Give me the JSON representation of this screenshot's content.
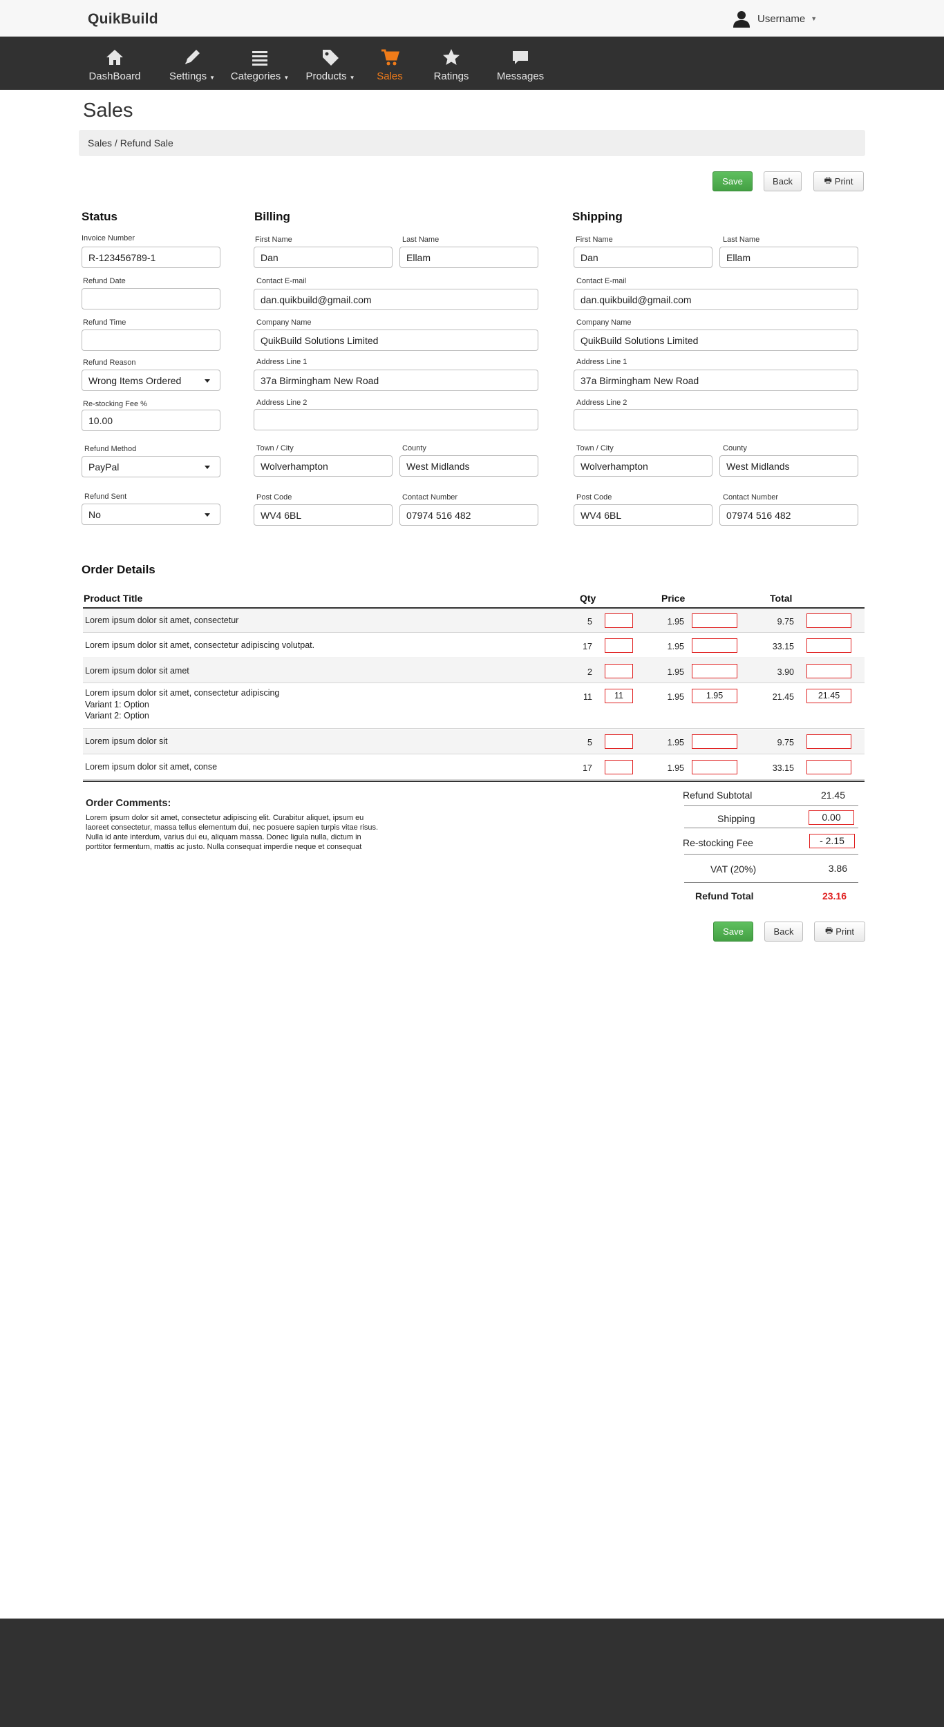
{
  "brand": "QuikBuild",
  "user": {
    "name": "Username"
  },
  "nav": [
    {
      "label": "DashBoard",
      "icon": "home-icon"
    },
    {
      "label": "Settings",
      "icon": "pencil-icon"
    },
    {
      "label": "Categories",
      "icon": "list-icon"
    },
    {
      "label": "Products",
      "icon": "tag-icon"
    },
    {
      "label": "Sales",
      "icon": "cart-icon"
    },
    {
      "label": "Ratings",
      "icon": "star-icon"
    },
    {
      "label": "Messages",
      "icon": "chat-icon"
    }
  ],
  "page": {
    "title": "Sales",
    "breadcrumb": "Sales / Refund Sale"
  },
  "buttons": {
    "save": "Save",
    "back": "Back",
    "print": "Print"
  },
  "status": {
    "heading": "Status",
    "invoice_label": "Invoice Number",
    "invoice": "R-123456789-1",
    "refund_date_label": "Refund Date",
    "refund_date": "",
    "refund_time_label": "Refund Time",
    "refund_time": "",
    "reason_label": "Refund Reason",
    "reason": "Wrong Items Ordered",
    "fee_label": "Re-stocking Fee %",
    "fee": "10.00",
    "method_label": "Refund Method",
    "method": "PayPal",
    "sent_label": "Refund Sent",
    "sent": "No"
  },
  "billing": {
    "heading": "Billing",
    "first_name_label": "First Name",
    "first_name": "Dan",
    "last_name_label": "Last Name",
    "last_name": "Ellam",
    "email_label": "Contact E-mail",
    "email": "dan.quikbuild@gmail.com",
    "company_label": "Company Name",
    "company": "QuikBuild Solutions Limited",
    "addr1_label": "Address Line 1",
    "addr1": "37a Birmingham New Road",
    "addr2_label": "Address Line 2",
    "addr2": "",
    "town_label": "Town / City",
    "town": "Wolverhampton",
    "county_label": "County",
    "county": "West Midlands",
    "postcode_label": "Post Code",
    "postcode": "WV4 6BL",
    "phone_label": "Contact Number",
    "phone": "07974 516 482"
  },
  "shipping": {
    "heading": "Shipping",
    "first_name_label": "First Name",
    "first_name": "Dan",
    "last_name_label": "Last Name",
    "last_name": "Ellam",
    "email_label": "Contact E-mail",
    "email": "dan.quikbuild@gmail.com",
    "company_label": "Company Name",
    "company": "QuikBuild Solutions Limited",
    "addr1_label": "Address Line 1",
    "addr1": "37a Birmingham New Road",
    "addr2_label": "Address Line 2",
    "addr2": "",
    "town_label": "Town / City",
    "town": "Wolverhampton",
    "county_label": "County",
    "county": "West Midlands",
    "postcode_label": "Post Code",
    "postcode": "WV4 6BL",
    "phone_label": "Contact Number",
    "phone": "07974 516 482"
  },
  "order": {
    "heading": "Order Details",
    "col_title": "Product Title",
    "col_qty": "Qty",
    "col_price": "Price",
    "col_total": "Total",
    "rows": [
      {
        "title": "Lorem ipsum dolor sit amet, consectetur",
        "variants": [],
        "qty": "5",
        "price": "1.95",
        "total": "9.75",
        "qty_in": "",
        "price_in": "",
        "total_in": ""
      },
      {
        "title": "Lorem ipsum dolor sit amet, consectetur adipiscing volutpat.",
        "variants": [],
        "qty": "17",
        "price": "1.95",
        "total": "33.15",
        "qty_in": "",
        "price_in": "",
        "total_in": ""
      },
      {
        "title": "Lorem ipsum dolor sit amet",
        "variants": [],
        "qty": "2",
        "price": "1.95",
        "total": "3.90",
        "qty_in": "",
        "price_in": "",
        "total_in": ""
      },
      {
        "title": "Lorem ipsum dolor sit amet, consectetur adipiscing",
        "variants": [
          "Variant 1: Option",
          "Variant 2: Option"
        ],
        "qty": "11",
        "price": "1.95",
        "total": "21.45",
        "qty_in": "11",
        "price_in": "1.95",
        "total_in": "21.45"
      },
      {
        "title": "Lorem ipsum dolor sit",
        "variants": [],
        "qty": "5",
        "price": "1.95",
        "total": "9.75",
        "qty_in": "",
        "price_in": "",
        "total_in": ""
      },
      {
        "title": "Lorem ipsum dolor sit amet, conse",
        "variants": [],
        "qty": "17",
        "price": "1.95",
        "total": "33.15",
        "qty_in": "",
        "price_in": "",
        "total_in": ""
      }
    ]
  },
  "comments": {
    "heading": "Order Comments:",
    "body": "Lorem ipsum dolor sit amet, consectetur adipiscing elit. Curabitur aliquet, ipsum eu laoreet consectetur, massa tellus elementum dui, nec posuere sapien turpis vitae risus. Nulla id ante interdum, varius dui eu, aliquam massa. Donec ligula nulla, dictum in porttitor fermentum, mattis ac justo. Nulla consequat imperdie neque et consequat"
  },
  "totals": {
    "subtotal_label": "Refund Subtotal",
    "subtotal": "21.45",
    "shipping_label": "Shipping",
    "shipping": "0.00",
    "restock_label": "Re-stocking Fee",
    "restock": "- 2.15",
    "vat_label": "VAT (20%)",
    "vat": "3.86",
    "total_label": "Refund Total",
    "total": "23.16"
  },
  "colors": {
    "accent": "#f07b19",
    "save": "#4cae4c",
    "alert": "#e02020",
    "nav_bg": "#313131",
    "footer_bg": "#313131"
  }
}
